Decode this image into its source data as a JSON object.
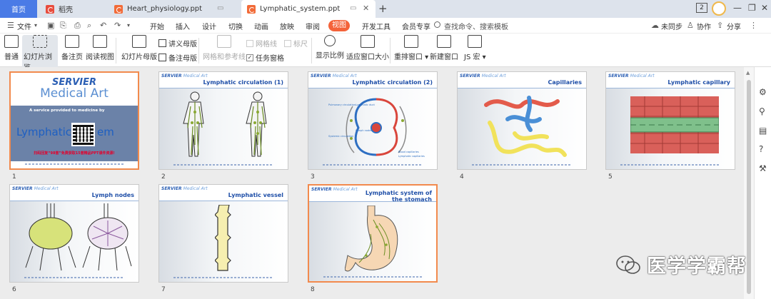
{
  "tabs": {
    "home": "首页",
    "daoke": "稻壳",
    "doc1": "Heart_physiology.ppt",
    "doc2": "Lymphatic_system.ppt",
    "new_tab": "+",
    "account_badge": "2"
  },
  "menu": {
    "file": "文件",
    "items": [
      "开始",
      "插入",
      "设计",
      "切换",
      "动画",
      "放映",
      "审阅",
      "视图",
      "开发工具",
      "会员专享"
    ],
    "search_placeholder": "查找命令、搜索模板",
    "unsync": "未同步",
    "collab": "协作",
    "share": "分享"
  },
  "ribbon": {
    "normal": "普通",
    "slide_browse": "幻灯片浏览",
    "notes_page": "备注页",
    "reading_view": "阅读视图",
    "slide_master": "幻灯片母版",
    "handout_master": "讲义母版",
    "notes_master": "备注母版",
    "grid_guides": "网格和参考线",
    "gridlines": "网格线",
    "ruler": "标尺",
    "task_pane": "任务窗格",
    "show_ratio": "显示比例",
    "fit_window": "适应窗口大小",
    "rearrange_windows": "重排窗口",
    "new_window": "新建窗口",
    "js_macro": "JS 宏"
  },
  "slides": [
    {
      "number": "1",
      "brand": "SERVIER",
      "brand_sub": "Medical Art",
      "subtitle": "A service provided to medicine by",
      "title_left": "Lymphatic",
      "title_right": "em",
      "promo": "扫码回复“98套”免费获取15套精品PPT课件资源!"
    },
    {
      "number": "2",
      "brand": "SERVIER",
      "brand_sub": "Medical Art",
      "title": "Lymphatic circulation (1)"
    },
    {
      "number": "3",
      "brand": "SERVIER",
      "brand_sub": "Medical Art",
      "title": "Lymphatic circulation (2)",
      "labels": [
        "Pulmonary circulation",
        "Lymphatic duct",
        "Lymph nodes",
        "Systemic circulation",
        "Blood capillaries",
        "Lymphatic capillaries"
      ]
    },
    {
      "number": "4",
      "brand": "SERVIER",
      "brand_sub": "Medical Art",
      "title": "Capillaries"
    },
    {
      "number": "5",
      "brand": "SERVIER",
      "brand_sub": "Medical Art",
      "title": "Lymphatic capillary"
    },
    {
      "number": "6",
      "brand": "SERVIER",
      "brand_sub": "Medical Art",
      "title": "Lymph nodes"
    },
    {
      "number": "7",
      "brand": "SERVIER",
      "brand_sub": "Medical Art",
      "title": "Lymphatic vessel"
    },
    {
      "number": "8",
      "brand": "SERVIER",
      "brand_sub": "Medical Art",
      "title": "Lymphatic system of the stomach"
    }
  ],
  "watermark": "医学学霸帮",
  "colors": {
    "accent": "#f4633a",
    "home_tab": "#4a7be6",
    "selection": "#f28a4d",
    "brand_blue": "#2b5fb4"
  }
}
